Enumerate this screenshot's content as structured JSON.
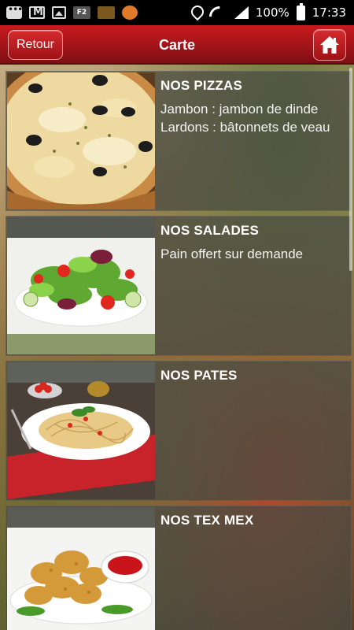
{
  "status_bar": {
    "time": "17:33",
    "battery": "100%",
    "icons": [
      "message-icon",
      "gmail-icon",
      "gallery-icon",
      "f2-icon",
      "game-icon",
      "app-icon",
      "location-icon",
      "wifi-icon",
      "signal-icon",
      "battery-icon"
    ]
  },
  "header": {
    "back_label": "Retour",
    "title": "Carte",
    "home_icon": "home-icon",
    "accent_color": "#b3171b"
  },
  "items": [
    {
      "title": "NOS PIZZAS",
      "description": [
        "Jambon : jambon de dinde",
        "Lardons : bâtonnets de veau"
      ],
      "image": "pizza-photo"
    },
    {
      "title": "NOS SALADES",
      "description": [
        "Pain offert sur demande"
      ],
      "image": "salad-photo"
    },
    {
      "title": "NOS PATES",
      "description": [],
      "image": "pasta-photo"
    },
    {
      "title": "NOS TEX MEX",
      "description": [],
      "image": "texmex-photo"
    }
  ]
}
